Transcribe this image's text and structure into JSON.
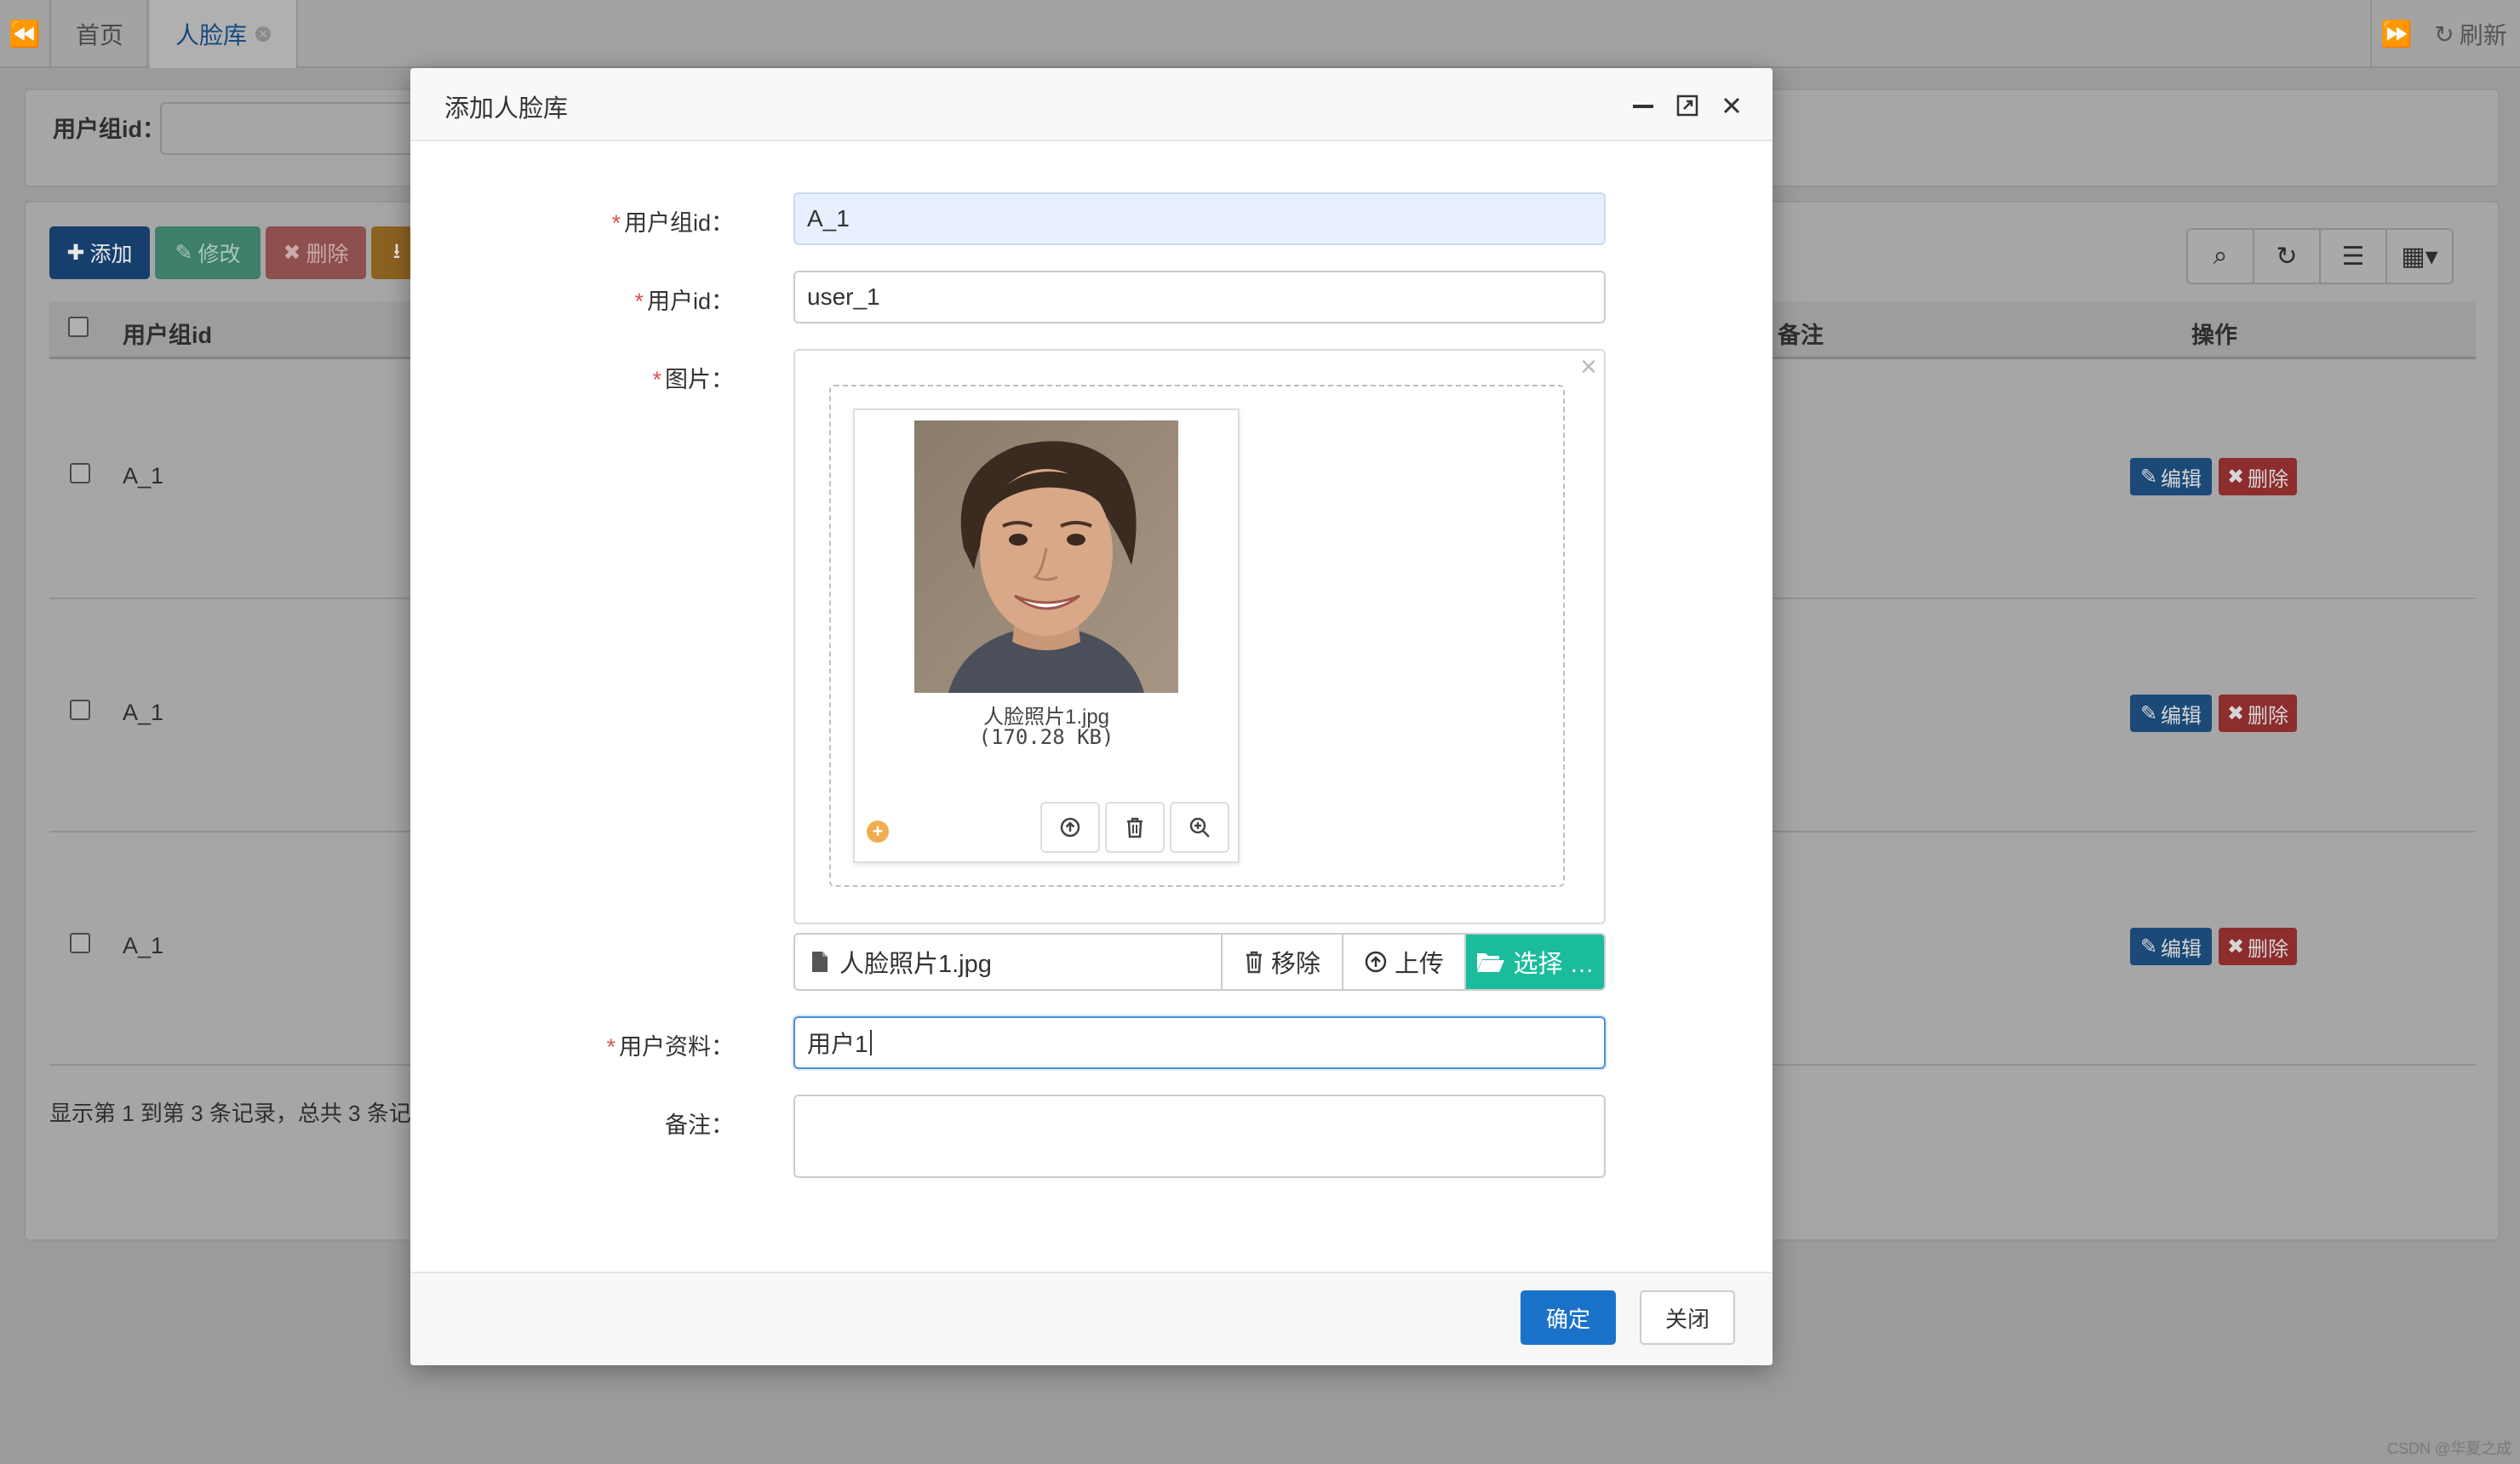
{
  "tabs": {
    "home": "首页",
    "face_library": "人脸库",
    "refresh": "刷新"
  },
  "search": {
    "group_label": "用户组id："
  },
  "toolbar": {
    "add": "添加",
    "edit": "修改",
    "delete": "删除"
  },
  "table": {
    "headers": {
      "group_id": "用户组id",
      "remark": "备注",
      "actions": "操作"
    },
    "rows": [
      {
        "group_id": "A_1",
        "edit": "编辑",
        "delete": "删除"
      },
      {
        "group_id": "A_1",
        "edit": "编辑",
        "delete": "删除"
      },
      {
        "group_id": "A_1",
        "edit": "编辑",
        "delete": "删除"
      }
    ],
    "footer": "显示第 1 到第 3 条记录，总共 3 条记"
  },
  "modal": {
    "title": "添加人脸库",
    "labels": {
      "group_id": "用户组id：",
      "user_id": "用户id：",
      "image": "图片：",
      "user_data": "用户资料：",
      "remark": "备注："
    },
    "values": {
      "group_id": "A_1",
      "user_id": "user_1",
      "user_data": "用户1",
      "remark": ""
    },
    "required_mark": "*",
    "upload": {
      "file_name": "人脸照片1.jpg",
      "file_size": "(170.28 KB)",
      "caption": "人脸照片1.jpg",
      "remove": "移除",
      "upload": "上传",
      "browse": "选择 …"
    },
    "buttons": {
      "ok": "确定",
      "close": "关闭"
    }
  },
  "watermark": "CSDN @华夏之成",
  "colors": {
    "primary": "#1a73c9",
    "success": "#1abc9c",
    "danger": "#d9534f",
    "warning": "#f0ad4e"
  }
}
